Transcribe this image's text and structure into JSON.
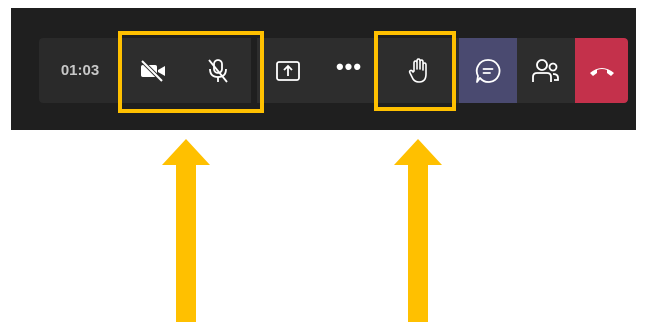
{
  "call_controls": {
    "timer": "01:03",
    "buttons": [
      {
        "name": "camera-off",
        "icon": "video-off-icon"
      },
      {
        "name": "mic-off",
        "icon": "mic-off-icon"
      },
      {
        "name": "share",
        "icon": "share-screen-icon"
      },
      {
        "name": "more",
        "icon": "more-dots-icon",
        "glyph": "•••"
      },
      {
        "name": "raise-hand",
        "icon": "raise-hand-icon"
      },
      {
        "name": "chat",
        "icon": "chat-icon"
      },
      {
        "name": "participants",
        "icon": "people-icon"
      },
      {
        "name": "hang-up",
        "icon": "phone-hangup-icon"
      }
    ]
  },
  "colors": {
    "toolbar_background": "#1f1f1f",
    "button_background": "#2d2d2d",
    "chat_active": "#4a4a70",
    "hang_up": "#c4314b",
    "highlight": "#ffc000"
  }
}
